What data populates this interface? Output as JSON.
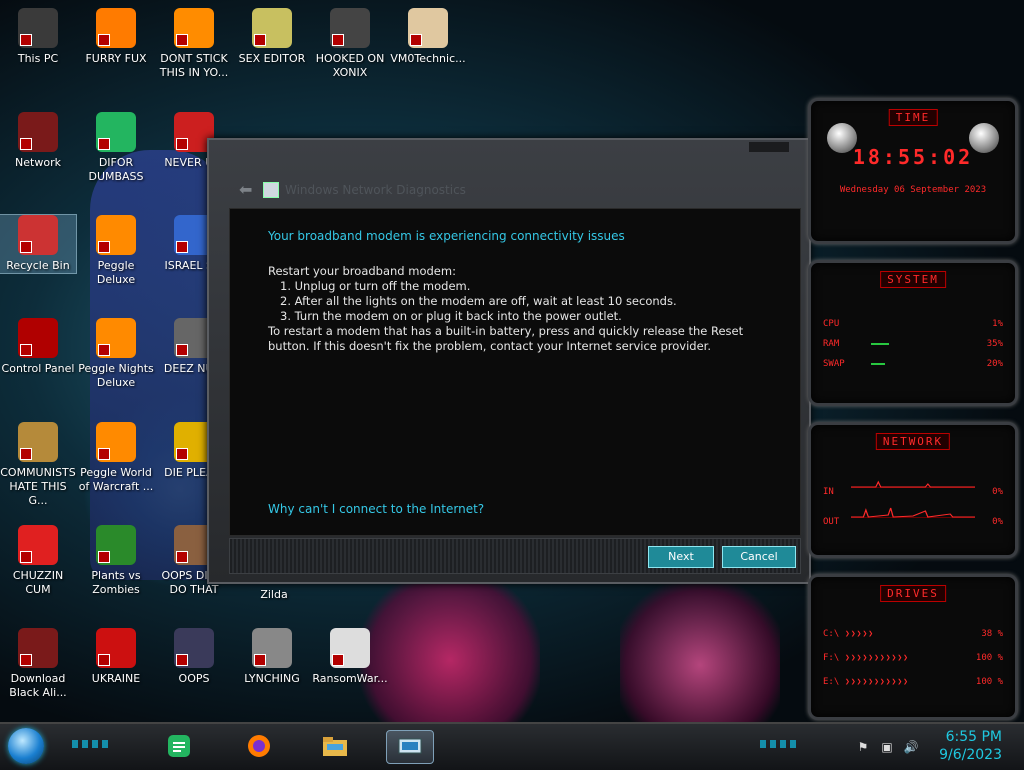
{
  "desktop_icons": [
    {
      "label": "This PC",
      "icon": "computer-icon",
      "color": "#3a3a3a"
    },
    {
      "label": "FURRY FUX",
      "icon": "firefox-icon",
      "color": "#ff7b00"
    },
    {
      "label": "DONT STICK THIS IN YO...",
      "icon": "vlc-cone-icon",
      "color": "#ff8c00"
    },
    {
      "label": "SEX EDITOR",
      "icon": "hxd-icon",
      "color": "#c8c060"
    },
    {
      "label": "HOOKED ON XONIX",
      "icon": "xonix-icon",
      "color": "#444444"
    },
    {
      "label": "VM0Technic...",
      "icon": "doctor-icon",
      "color": "#e0c8a0"
    },
    {
      "label": "Network",
      "icon": "network-orb-icon",
      "color": "#7a1a1a"
    },
    {
      "label": "DIFOR DUMBASS",
      "icon": "discord-icon",
      "color": "#23b560"
    },
    {
      "label": "NEVER U...",
      "icon": "dev-icon",
      "color": "#cc1f1f"
    },
    {
      "label": "Recycle Bin",
      "icon": "recycle-bin-icon",
      "color": "#cc3333"
    },
    {
      "label": "Peggle Deluxe",
      "icon": "peggle-icon",
      "color": "#ff8a00"
    },
    {
      "label": "ISRAEL S...",
      "icon": "flag-icon",
      "color": "#3366cc"
    },
    {
      "label": "Control Panel",
      "icon": "control-panel-icon",
      "color": "#b00000"
    },
    {
      "label": "Peggle Nights Deluxe",
      "icon": "peggle-nights-icon",
      "color": "#ff8a00"
    },
    {
      "label": "DEEZ NU...",
      "icon": "window-stack-icon",
      "color": "#666666"
    },
    {
      "label": "COMMUNISTS HATE THIS G...",
      "icon": "money-bag-icon",
      "color": "#b58a3a"
    },
    {
      "label": "Peggle World of Warcraft ...",
      "icon": "peggle-wow-icon",
      "color": "#ff8a00"
    },
    {
      "label": "DIE PLEA...",
      "icon": "die-icon",
      "color": "#e0b000"
    },
    {
      "label": "CHUZZIN CUM",
      "icon": "chuzzle-icon",
      "color": "#e02020"
    },
    {
      "label": "Plants vs Zombies",
      "icon": "plants-icon",
      "color": "#2a8a2a"
    },
    {
      "label": "OOPS DID... DO THAT",
      "icon": "portrait-icon",
      "color": "#8a6040"
    },
    {
      "label": "Download Black Ali...",
      "icon": "alien-orb-icon",
      "color": "#7a1a1a"
    },
    {
      "label": "UKRAINE",
      "icon": "radiation-icon",
      "color": "#cc1010"
    },
    {
      "label": "OOPS",
      "icon": "monitor-icon",
      "color": "#3a3a5a"
    },
    {
      "label": "LYNCHING",
      "icon": "knot-icon",
      "color": "#888888"
    },
    {
      "label": "RansomWar...",
      "icon": "skull-icon",
      "color": "#dddddd"
    }
  ],
  "partial_labels": {
    "midnight": "Zilda"
  },
  "dialog": {
    "title": "Windows Network Diagnostics",
    "headline": "Your broadband modem is experiencing connectivity issues",
    "intro": "Restart your broadband modem:",
    "steps": [
      "1.  Unplug or turn off the modem.",
      "2.  After all the lights on the modem are off, wait at least 10 seconds.",
      "3.  Turn the modem on or plug it back into the power outlet."
    ],
    "note": "To restart a modem that has a built-in battery, press and quickly release the Reset button. If this doesn't fix the problem, contact your Internet service provider.",
    "help_link": "Why can't I connect to the Internet?",
    "next_label": "Next",
    "cancel_label": "Cancel"
  },
  "gadgets": {
    "time": {
      "header": "TIME",
      "time": "18:55:02",
      "date": "Wednesday 06 September 2023"
    },
    "system": {
      "header": "SYSTEM",
      "rows": [
        {
          "label": "CPU",
          "value": "1%"
        },
        {
          "label": "RAM",
          "value": "35%"
        },
        {
          "label": "SWAP",
          "value": "20%"
        }
      ]
    },
    "network": {
      "header": "NETWORK",
      "rows": [
        {
          "label": "IN",
          "value": "0%"
        },
        {
          "label": "OUT",
          "value": "0%"
        }
      ]
    },
    "drives": {
      "header": "DRIVES",
      "rows": [
        {
          "label": "C:\\",
          "value": "38 %"
        },
        {
          "label": "F:\\",
          "value": "100 %"
        },
        {
          "label": "E:\\",
          "value": "100 %"
        }
      ]
    }
  },
  "taskbar": {
    "apps": [
      "discord-icon",
      "firefox-icon",
      "file-explorer-icon",
      "network-diagnostics-icon"
    ],
    "time": "6:55 PM",
    "date": "9/6/2023"
  },
  "colors": {
    "accent": "#35c8e6",
    "gadget_red": "#ff2a2a",
    "button": "#1f8a98"
  }
}
